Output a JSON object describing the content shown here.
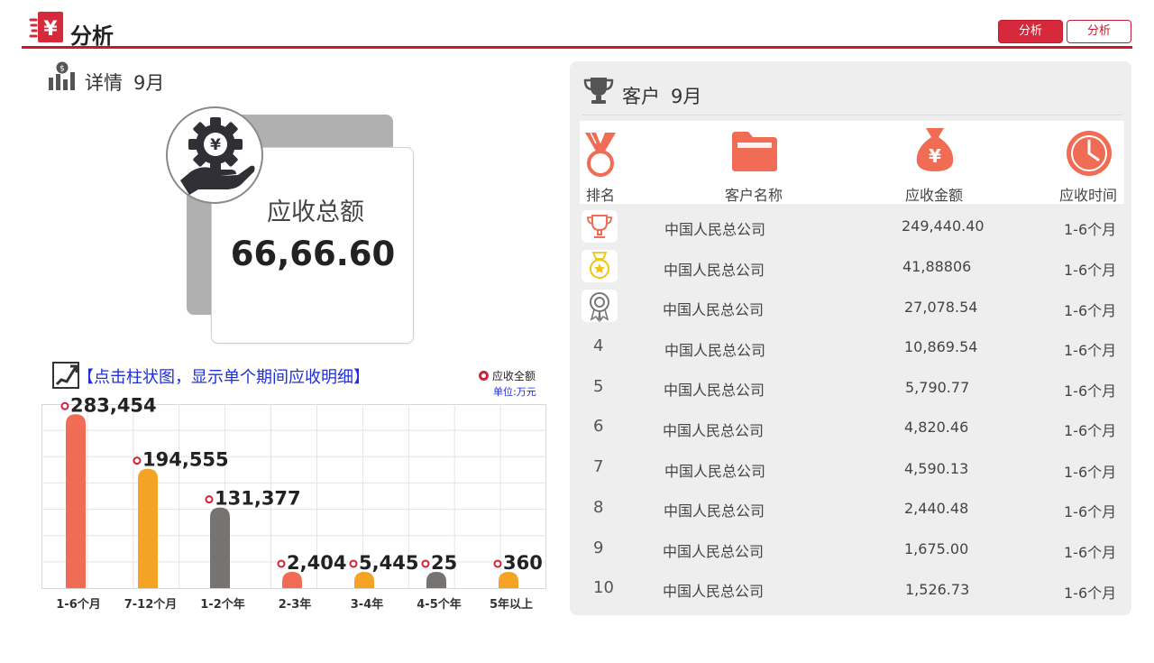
{
  "header": {
    "title": "分析",
    "btn_primary": "分析",
    "btn_outline": "分析"
  },
  "detail": {
    "title": "详情",
    "month": "9月",
    "total_label": "应收总额",
    "total_value": "66,66.60"
  },
  "chart_hint": "【点击柱状图，显示单个期间应收明细】",
  "legend_label": "应收全额",
  "unit_label": "单位:万元",
  "chart_data": {
    "type": "bar",
    "categories": [
      "1-6个月",
      "7-12个月",
      "1-2个年",
      "2-3年",
      "3-4年",
      "4-5个年",
      "5年以上"
    ],
    "values": [
      283454,
      194555,
      131377,
      2404,
      5445,
      25,
      360
    ],
    "labels": [
      "283,454",
      "194,555",
      "131,377",
      "2,404",
      "5,445",
      "25",
      "360"
    ],
    "colors": [
      "#f06c55",
      "#f5a324",
      "#777370",
      "#f06c55",
      "#f5a324",
      "#777370",
      "#f5a324"
    ],
    "legend": [
      "应收全额"
    ],
    "grid": true
  },
  "customers": {
    "title": "客户",
    "month": "9月",
    "columns": [
      "排名",
      "客户名称",
      "应收金额",
      "应收时间"
    ],
    "rows": [
      {
        "rank": "1",
        "name": "中国人民总公司",
        "amount": "249,440.40",
        "period": "1-6个月"
      },
      {
        "rank": "2",
        "name": "中国人民总公司",
        "amount": "41,88806",
        "period": "1-6个月"
      },
      {
        "rank": "3",
        "name": "中国人民总公司",
        "amount": "27,078.54",
        "period": "1-6个月"
      },
      {
        "rank": "4",
        "name": "中国人民总公司",
        "amount": "10,869.54",
        "period": "1-6个月"
      },
      {
        "rank": "5",
        "name": "中国人民总公司",
        "amount": "5,790.77",
        "period": "1-6个月"
      },
      {
        "rank": "6",
        "name": "中国人民总公司",
        "amount": "4,820.46",
        "period": "1-6个月"
      },
      {
        "rank": "7",
        "name": "中国人民总公司",
        "amount": "4,590.13",
        "period": "1-6个月"
      },
      {
        "rank": "8",
        "name": "中国人民总公司",
        "amount": "2,440.48",
        "period": "1-6个月"
      },
      {
        "rank": "9",
        "name": "中国人民总公司",
        "amount": "1,675.00",
        "period": "1-6个月"
      },
      {
        "rank": "10",
        "name": "中国人民总公司",
        "amount": "1,526.73",
        "period": "1-6个月"
      }
    ]
  },
  "icons": {
    "logo": "yen-logo-icon",
    "detail": "bar-chart-coin-icon",
    "money": "yen-gear-hand-icon",
    "chart": "trend-arrow-icon",
    "trophy": "trophy-icon",
    "rank_head": "medal-icon",
    "name_head": "folder-icon",
    "amount_head": "money-bag-icon",
    "time_head": "clock-icon",
    "gold": "trophy-badge-icon",
    "silver": "star-medal-icon",
    "bronze": "rosette-icon"
  }
}
